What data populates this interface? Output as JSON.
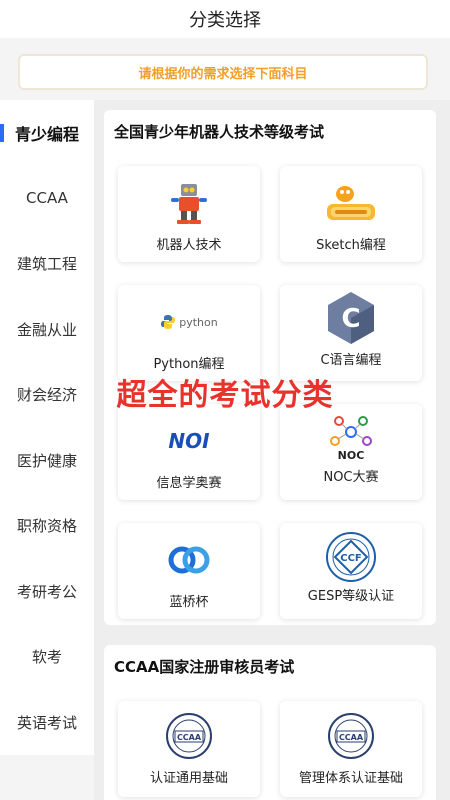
{
  "header": {
    "title": "分类选择"
  },
  "notice": {
    "text": "请根据你的需求选择下面科目"
  },
  "sidebar": {
    "items": [
      {
        "label": "青少编程",
        "active": true
      },
      {
        "label": "CCAA"
      },
      {
        "label": "建筑工程"
      },
      {
        "label": "金融从业"
      },
      {
        "label": "财会经济"
      },
      {
        "label": "医护健康"
      },
      {
        "label": "职称资格"
      },
      {
        "label": "考研考公"
      },
      {
        "label": "软考"
      },
      {
        "label": "英语考试"
      }
    ]
  },
  "sections": [
    {
      "title": "全国青少年机器人技术等级考试",
      "cards": [
        {
          "label": "机器人技术",
          "icon": "robot-icon"
        },
        {
          "label": "Sketch编程",
          "icon": "scratch-icon"
        },
        {
          "label": "Python编程",
          "icon": "python-icon",
          "icon_text": "python"
        },
        {
          "label": "C语言编程",
          "icon": "c-language-icon",
          "icon_text": "C"
        },
        {
          "label": "信息学奥赛",
          "icon": "noi-icon",
          "icon_text": "NOI"
        },
        {
          "label": "NOC大赛",
          "icon": "noc-icon",
          "icon_text": "NOC"
        },
        {
          "label": "蓝桥杯",
          "icon": "lanqiao-icon"
        },
        {
          "label": "GESP等级认证",
          "icon": "ccf-icon",
          "icon_text": "CCF"
        }
      ]
    },
    {
      "title": "CCAA国家注册审核员考试",
      "cards": [
        {
          "label": "认证通用基础",
          "icon": "ccaa-icon",
          "icon_text": "CCAA"
        },
        {
          "label": "管理体系认证基础",
          "icon": "ccaa-icon",
          "icon_text": "CCAA"
        }
      ]
    }
  ],
  "overlay": {
    "text": "超全的考试分类"
  },
  "colors": {
    "accent": "#2b6cf6",
    "notice": "#f0a028",
    "overlay": "#e8322b"
  }
}
